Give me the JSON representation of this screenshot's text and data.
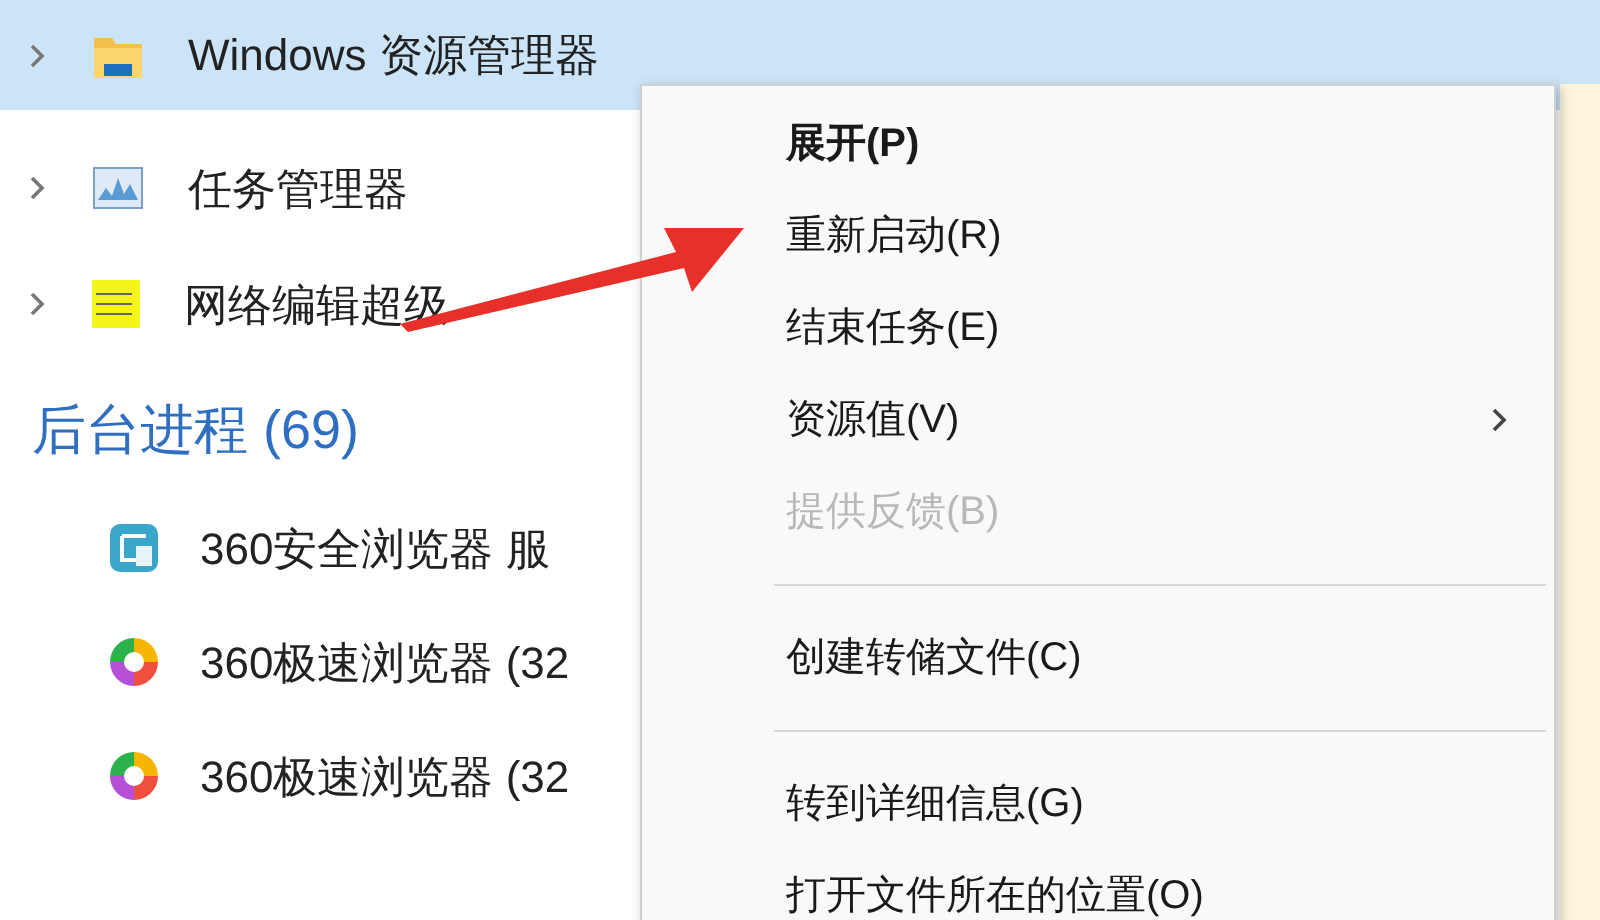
{
  "apps": [
    {
      "label": "Windows 资源管理器",
      "kind": "folder",
      "selected": true,
      "expanded": false
    },
    {
      "label": "任务管理器",
      "kind": "monitor",
      "selected": false,
      "expanded": false
    },
    {
      "label": "网络编辑超级",
      "kind": "notes",
      "selected": false,
      "expanded": false
    }
  ],
  "background_section": {
    "title": "后台进程 (69)",
    "processes": [
      {
        "label": "360安全浏览器 服",
        "kind": "shield"
      },
      {
        "label": "360极速浏览器 (32",
        "kind": "swirl"
      },
      {
        "label": "360极速浏览器 (32",
        "kind": "swirl"
      }
    ]
  },
  "context_menu": {
    "items": [
      {
        "kind": "item",
        "label": "展开(P)",
        "bold": true,
        "disabled": false,
        "submenu": false
      },
      {
        "kind": "item",
        "label": "重新启动(R)",
        "bold": false,
        "disabled": false,
        "submenu": false
      },
      {
        "kind": "item",
        "label": "结束任务(E)",
        "bold": false,
        "disabled": false,
        "submenu": false
      },
      {
        "kind": "item",
        "label": "资源值(V)",
        "bold": false,
        "disabled": false,
        "submenu": true
      },
      {
        "kind": "item",
        "label": "提供反馈(B)",
        "bold": false,
        "disabled": true,
        "submenu": false
      },
      {
        "kind": "separator"
      },
      {
        "kind": "item",
        "label": "创建转储文件(C)",
        "bold": false,
        "disabled": false,
        "submenu": false
      },
      {
        "kind": "separator"
      },
      {
        "kind": "item",
        "label": "转到详细信息(G)",
        "bold": false,
        "disabled": false,
        "submenu": false
      },
      {
        "kind": "item",
        "label": "打开文件所在的位置(O)",
        "bold": false,
        "disabled": false,
        "submenu": false
      }
    ]
  }
}
